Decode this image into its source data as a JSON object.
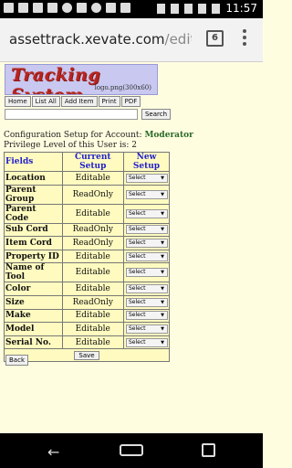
{
  "status_bar": {
    "time": "11:57",
    "left_icons": [
      "gallery-icon",
      "facebook-icon",
      "tools-icon",
      "facebook-icon",
      "chat-icon",
      "image-icon",
      "sync-icon",
      "upload-icon",
      "mail-icon"
    ],
    "right_icons": [
      "bluetooth-icon",
      "vibrate-icon",
      "wifi-icon",
      "signal-icon",
      "battery-icon"
    ]
  },
  "browser": {
    "url_main": "assettrack.xevate.com",
    "url_rest": "/edituser",
    "tab_count": "6"
  },
  "header": {
    "logo_title": "Tracking System",
    "logo_sub": "logo.png(300x60)"
  },
  "nav": {
    "items": [
      "Home",
      "List All",
      "Add Item",
      "Print",
      "PDF"
    ]
  },
  "search": {
    "value": "",
    "button_label": "Search"
  },
  "config": {
    "prefix": "Configuration Setup for Account: ",
    "account": "Moderator",
    "privilege_prefix": "Privilege Level of this User is: ",
    "privilege_level": "2"
  },
  "table": {
    "headers": [
      "Fields",
      "Current Setup",
      "New Setup"
    ],
    "rows": [
      {
        "field": "Location",
        "current": "Editable",
        "select": "Select"
      },
      {
        "field": "Parent Group",
        "current": "ReadOnly",
        "select": "Select"
      },
      {
        "field": "Parent Code",
        "current": "Editable",
        "select": "Select"
      },
      {
        "field": "Sub Cord",
        "current": "ReadOnly",
        "select": "Select"
      },
      {
        "field": "Item Cord",
        "current": "ReadOnly",
        "select": "Select"
      },
      {
        "field": "Property ID",
        "current": "Editable",
        "select": "Select"
      },
      {
        "field": "Name of Tool",
        "current": "Editable",
        "select": "Select"
      },
      {
        "field": "Color",
        "current": "Editable",
        "select": "Select"
      },
      {
        "field": "Size",
        "current": "ReadOnly",
        "select": "Select"
      },
      {
        "field": "Make",
        "current": "Editable",
        "select": "Select"
      },
      {
        "field": "Model",
        "current": "Editable",
        "select": "Select"
      },
      {
        "field": "Serial No.",
        "current": "Editable",
        "select": "Select"
      }
    ],
    "save_label": "Save"
  },
  "back_label": "Back"
}
